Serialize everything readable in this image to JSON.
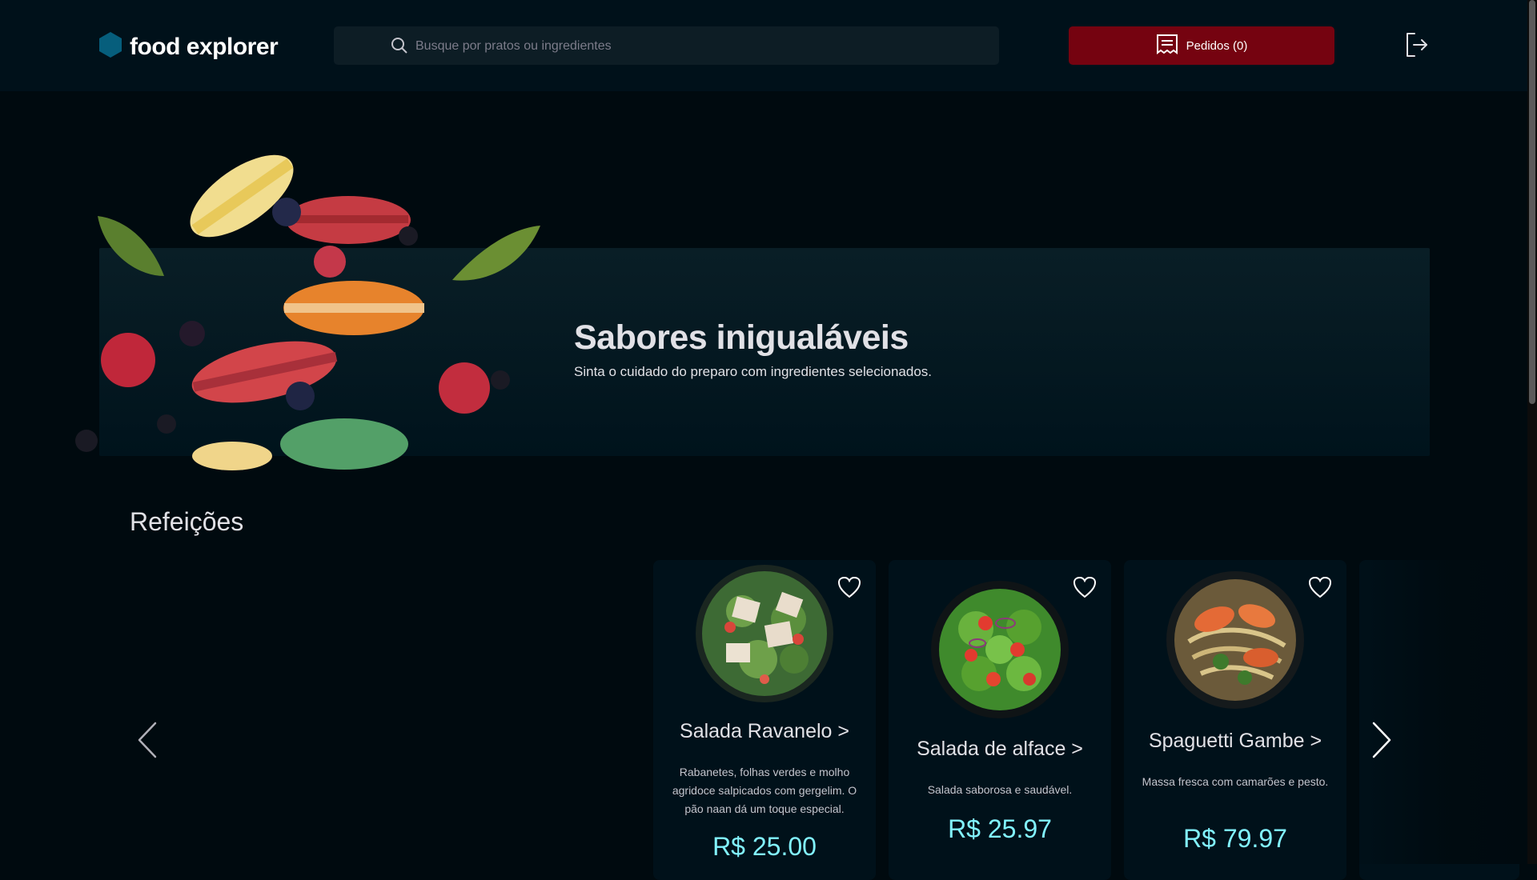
{
  "header": {
    "brand": "food explorer",
    "search_placeholder": "Busque por pratos ou ingredientes",
    "orders_label": "Pedidos (0)"
  },
  "banner": {
    "title": "Sabores inigualáveis",
    "subtitle": "Sinta o cuidado do preparo com ingredientes selecionados."
  },
  "section": {
    "title": "Refeições",
    "dishes": [
      {
        "name": "Salada Ravanelo >",
        "description": "Rabanetes, folhas verdes e molho agridoce salpicados com gergelim. O pão naan dá um toque especial.",
        "price": "R$ 25.00"
      },
      {
        "name": "Salada de alface >",
        "description": "Salada saborosa e saudável.",
        "price": "R$ 25.97"
      },
      {
        "name": "Spaguetti Gambe >",
        "description": "Massa fresca com camarões e pesto.",
        "price": "R$ 79.97"
      }
    ]
  },
  "colors": {
    "background": "#000a0f",
    "header": "#00111a",
    "accent_button": "#750310",
    "brand_hex": "#065e7c",
    "price": "#82f3ff"
  },
  "icons": {
    "logo": "hexagon-icon",
    "search": "search-icon",
    "orders": "receipt-icon",
    "logout": "sign-out-icon",
    "favorite": "heart-icon",
    "prev": "chevron-left-icon",
    "next": "chevron-right-icon"
  }
}
